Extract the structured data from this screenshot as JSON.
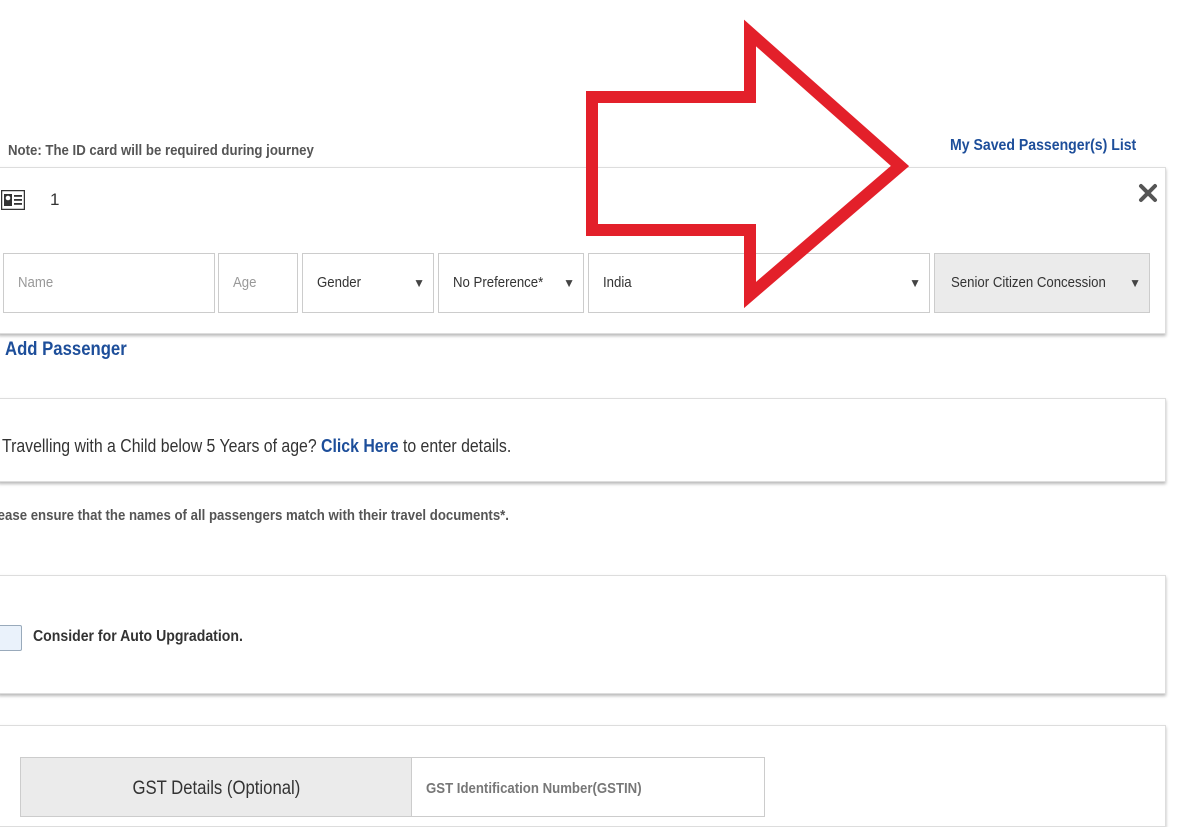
{
  "note": "Note: The ID card will be required during journey",
  "saved_list_link": "My Saved Passenger(s) List",
  "passenger": {
    "index": "1",
    "name_placeholder": "Name",
    "age_placeholder": "Age",
    "gender": "Gender",
    "berth_preference": "No Preference*",
    "nationality": "India",
    "concession": "Senior Citizen Concession"
  },
  "add_passenger": "Add Passenger",
  "child": {
    "prefix": "Travelling with a Child below 5 Years of age? ",
    "link": "Click Here",
    "suffix": " to enter details."
  },
  "ensure_note": "lease ensure that the names of all passengers match with their travel documents*.",
  "auto_upgrade_label": "Consider for Auto Upgradation.",
  "gst": {
    "tab_label": "GST Details (Optional)",
    "gstin_label": "GST Identification Number(GSTIN)"
  },
  "colors": {
    "link": "#1d4e9a",
    "annotation_arrow": "#e3202a"
  },
  "icons": [
    "id-card-icon",
    "close-icon",
    "dropdown-caret-icon",
    "arrow-annotation"
  ]
}
